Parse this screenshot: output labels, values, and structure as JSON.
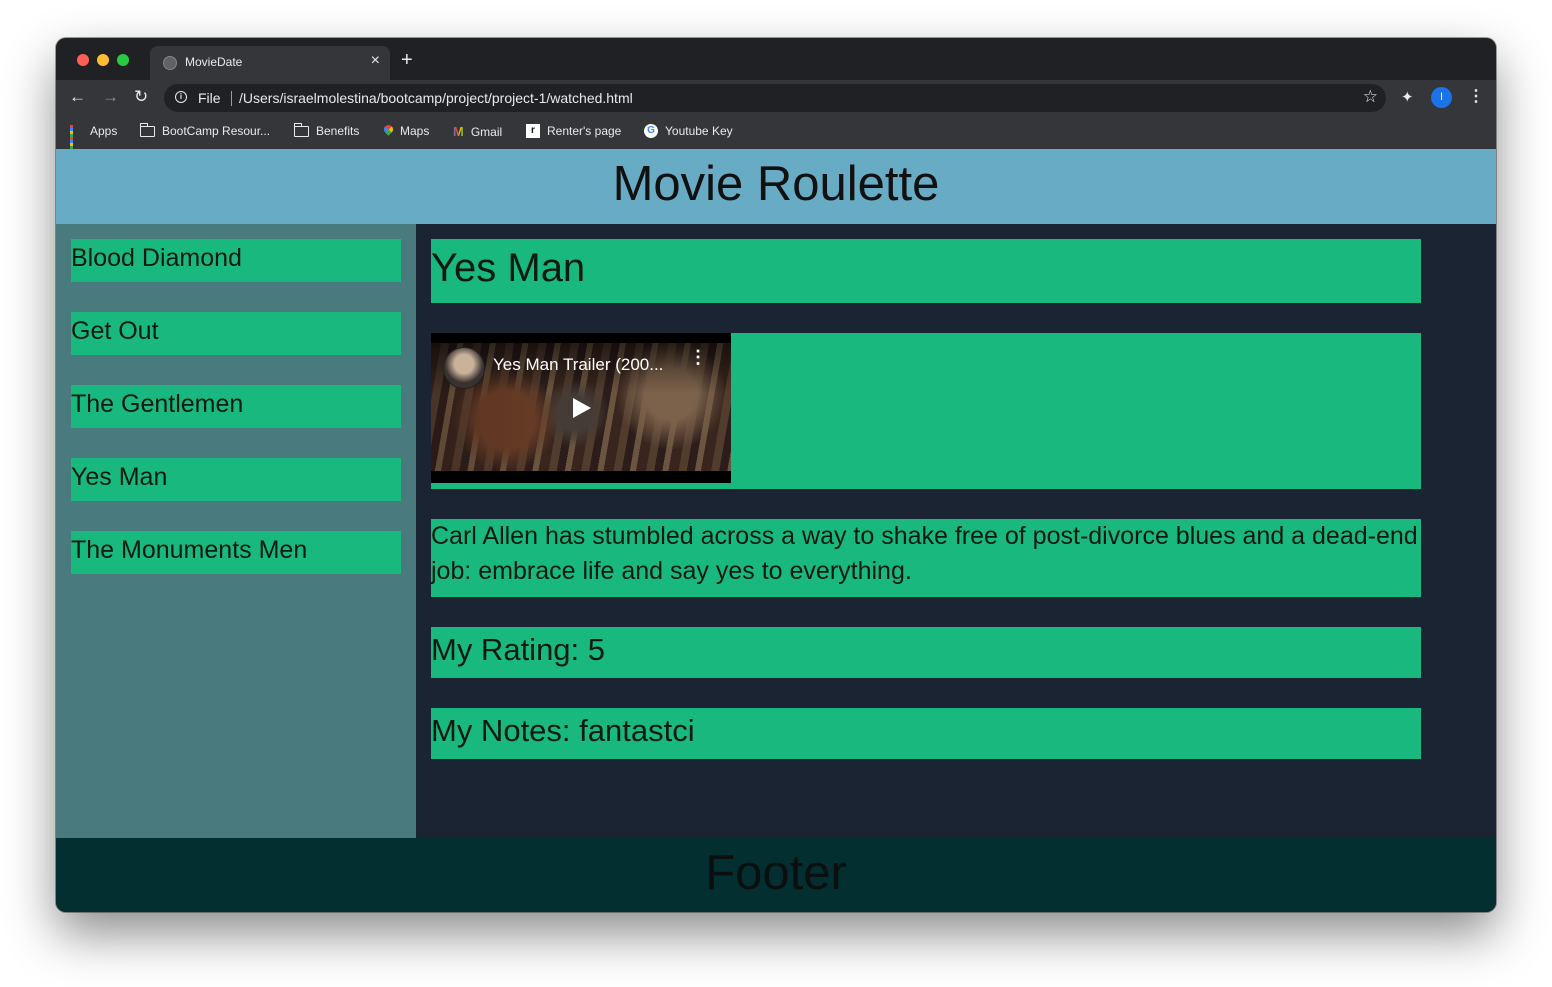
{
  "browser": {
    "tab_title": "MovieDate",
    "tab_close": "×",
    "new_tab": "+",
    "scheme_label": "File",
    "url": "/Users/israelmolestina/bootcamp/project/project-1/watched.html",
    "avatar_letter": "I",
    "bookmarks": [
      {
        "label": "Apps",
        "icon": "apps-grid-icon"
      },
      {
        "label": "BootCamp Resour...",
        "icon": "folder-icon"
      },
      {
        "label": "Benefits",
        "icon": "folder-icon"
      },
      {
        "label": "Maps",
        "icon": "maps-icon"
      },
      {
        "label": "Gmail",
        "icon": "gmail-icon"
      },
      {
        "label": "Renter's page",
        "icon": "renters-icon"
      },
      {
        "label": "Youtube Key",
        "icon": "google-icon"
      }
    ]
  },
  "page": {
    "header_title": "Movie Roulette",
    "sidebar": {
      "movies": [
        "Blood Diamond",
        "Get Out",
        "The Gentlemen",
        "Yes Man",
        "The Monuments Men"
      ]
    },
    "main": {
      "movie_title": "Yes Man",
      "video_title": "Yes Man Trailer (200...",
      "description": "Carl Allen has stumbled across a way to shake free of post-divorce blues and a dead-end job: embrace life and say yes to everything.",
      "rating": "My Rating: 5",
      "notes": "My Notes: fantastci"
    },
    "footer": "Footer"
  },
  "colors": {
    "header_bg": "#68abc4",
    "sidebar_bg": "#497a7e",
    "main_bg": "#1a2433",
    "card_green": "#19b87e",
    "footer_bg": "#032f30"
  }
}
